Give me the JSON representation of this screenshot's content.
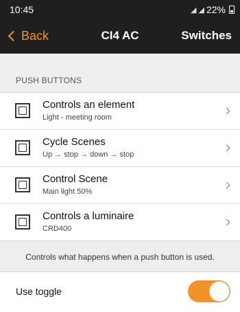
{
  "status_bar": {
    "time": "10:45",
    "signal_glyphs": "◢ ◢",
    "battery": "22%"
  },
  "nav": {
    "back_label": "Back",
    "title": "CI4 AC",
    "right_label": "Switches"
  },
  "section": {
    "header": "PUSH BUTTONS"
  },
  "items": [
    {
      "title": "Controls an element",
      "subtitle": "Light - meeting room"
    },
    {
      "title": "Cycle Scenes",
      "subtitle": "Up → stop → down → stop"
    },
    {
      "title": "Control Scene",
      "subtitle": "Main light 50%"
    },
    {
      "title": "Controls a luminaire",
      "subtitle": "CRD400"
    }
  ],
  "description": "Controls what happens when a push button is used.",
  "toggle": {
    "label": "Use toggle",
    "state": "on"
  },
  "colors": {
    "accent": "#f39229",
    "bar_background": "#1f1f1f",
    "page_background": "#efefef"
  }
}
